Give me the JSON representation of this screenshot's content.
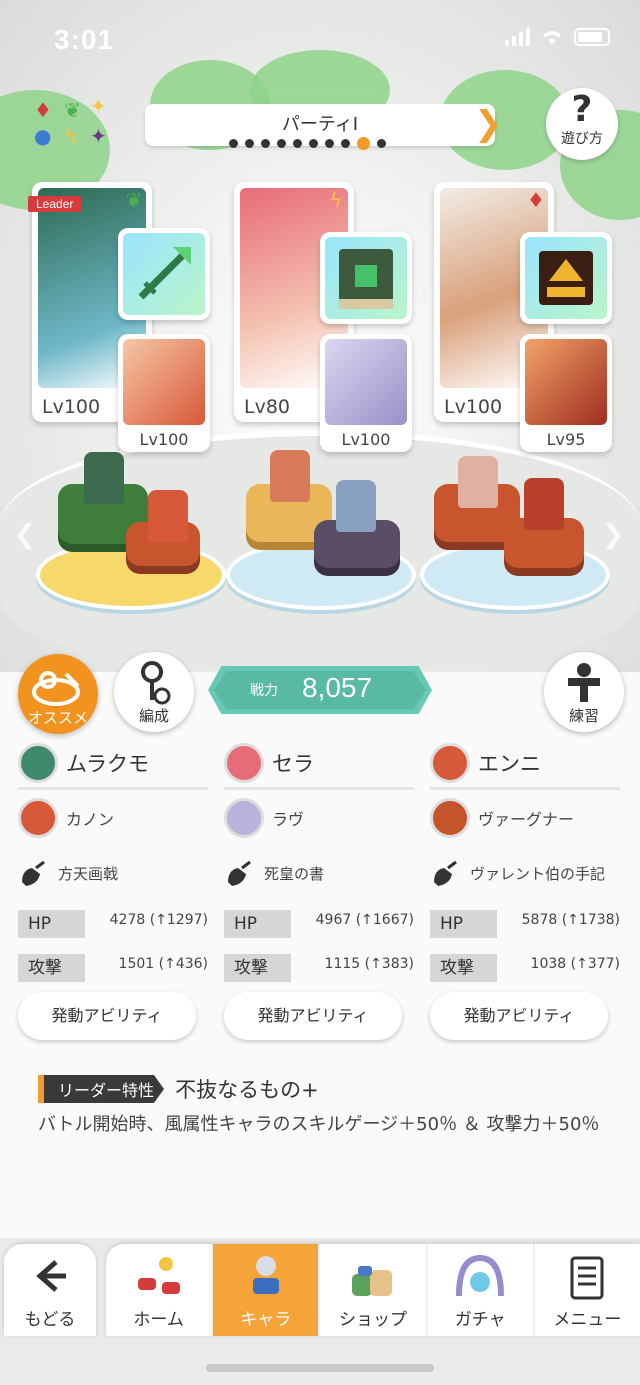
{
  "status_bar": {
    "time": "3:01"
  },
  "party": {
    "title": "パーティI",
    "page_count": 10,
    "active_index": 8
  },
  "help": {
    "label": "遊び方"
  },
  "leader_tag": "Leader",
  "slots": [
    {
      "main": {
        "name": "ムラクモ",
        "level": "Lv100",
        "attr_icon": "wind-leaf-icon",
        "color": "#3f8a6a"
      },
      "sub": {
        "name": "カノン",
        "level": "Lv100",
        "color": "#d8583a"
      },
      "weapon": {
        "name": "方天画戟",
        "color": "#6cd08a"
      },
      "stats": {
        "hp": "4278 (↑1297)",
        "atk": "1501 (↑436)"
      }
    },
    {
      "main": {
        "name": "セラ",
        "level": "Lv80",
        "attr_icon": "lightning-icon",
        "color": "#e86b7a"
      },
      "sub": {
        "name": "ラヴ",
        "level": "Lv100",
        "color": "#b9b3dc"
      },
      "weapon": {
        "name": "死皇の書",
        "color": "#3d7a4e"
      },
      "stats": {
        "hp": "4967 (↑1667)",
        "atk": "1115 (↑383)"
      }
    },
    {
      "main": {
        "name": "エンニ",
        "level": "Lv100",
        "attr_icon": "fire-diamond-icon",
        "color": "#d45a3a"
      },
      "sub": {
        "name": "ヴァーグナー",
        "level": "Lv95",
        "color": "#c4552b"
      },
      "weapon": {
        "name": "ヴァレント伯の手記",
        "color": "#e2a82a"
      },
      "stats": {
        "hp": "5878 (↑1738)",
        "atk": "1038 (↑377)"
      }
    }
  ],
  "stat_labels": {
    "hp": "HP",
    "atk": "攻撃"
  },
  "ability_button": "発動アビリティ",
  "buttons": {
    "recommend": "オススメ",
    "formation": "編成",
    "training": "練習"
  },
  "power": {
    "label": "戦力",
    "value": "8,057"
  },
  "leader_skill": {
    "tag": "リーダー特性",
    "name": "不抜なるもの+",
    "description": "バトル開始時、風属性キャラのスキルゲージ＋50％ ＆ 攻撃力＋50％"
  },
  "nav": {
    "back": "もどる",
    "tabs": [
      "ホーム",
      "キャラ",
      "ショップ",
      "ガチャ",
      "メニュー"
    ],
    "active_tab": 1
  },
  "colors": {
    "accent": "#f39a2c",
    "power_teal": "#58b9a4"
  }
}
